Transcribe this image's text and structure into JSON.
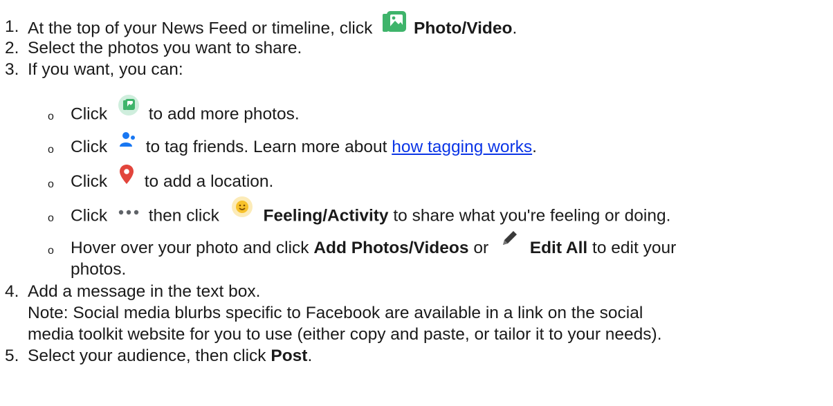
{
  "steps": [
    {
      "num": "1.",
      "pre": "At the top of your News Feed or timeline, click",
      "bold": "Photo/Video",
      "post": ".",
      "icon": "photo-video-icon"
    },
    {
      "num": "2.",
      "text": "Select the photos you want to share."
    },
    {
      "num": "3.",
      "text": "If you want, you can:"
    },
    {
      "num": "4.",
      "text": "Add a message in the text box."
    },
    {
      "num": "5.",
      "pre": "Select your audience, then click",
      "bold": "Post",
      "post": "."
    }
  ],
  "note": {
    "line1": "Note: Social media blurbs specific to Facebook are available in a link on the social",
    "line2": "media toolkit website for you to use (either copy and paste, or tailor it to your needs)."
  },
  "substeps": [
    {
      "bullet": "o",
      "pre": "Click",
      "post": "to add more photos.",
      "icon": "add-photo-icon"
    },
    {
      "bullet": "o",
      "pre": "Click",
      "mid": "to tag friends. Learn more about",
      "link": "how tagging works",
      "post": ".",
      "icon": "tag-friends-icon"
    },
    {
      "bullet": "o",
      "pre": "Click",
      "post": "to add a location.",
      "icon": "location-pin-icon"
    },
    {
      "bullet": "o",
      "pre": "Click",
      "mid": "then click",
      "bold": "Feeling/Activity",
      "post": "to share what you're feeling or doing.",
      "icon": "more-dots-icon",
      "icon2": "feeling-smiley-icon"
    },
    {
      "bullet": "o",
      "pre": "Hover over your photo and click",
      "bold": "Add Photos/Videos",
      "mid": "or",
      "bold2": "Edit All",
      "post": "to edit your",
      "line2": "photos.",
      "icon": "pencil-icon"
    }
  ],
  "colors": {
    "photo_green": "#3fb46b",
    "tag_blue": "#1877f2",
    "pin_red": "#e2453c",
    "feeling_yellow": "#f7c12a",
    "link_blue": "#0b35e6",
    "text": "#1a1a1a"
  }
}
